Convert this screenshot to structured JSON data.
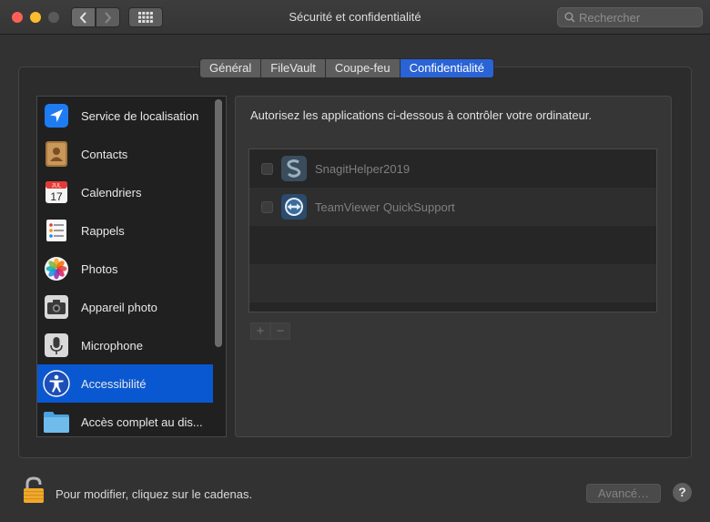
{
  "window": {
    "title": "Sécurité et confidentialité"
  },
  "search": {
    "placeholder": "Rechercher"
  },
  "tabs": [
    {
      "label": "Général",
      "active": false
    },
    {
      "label": "FileVault",
      "active": false
    },
    {
      "label": "Coupe-feu",
      "active": false
    },
    {
      "label": "Confidentialité",
      "active": true
    }
  ],
  "sidebar": {
    "items": [
      {
        "label": "Service de localisation",
        "icon": "location-arrow-icon"
      },
      {
        "label": "Contacts",
        "icon": "contacts-book-icon"
      },
      {
        "label": "Calendriers",
        "icon": "calendar-icon",
        "icon_month": "JUL",
        "icon_day": "17"
      },
      {
        "label": "Rappels",
        "icon": "reminders-list-icon"
      },
      {
        "label": "Photos",
        "icon": "photos-flower-icon"
      },
      {
        "label": "Appareil photo",
        "icon": "camera-icon"
      },
      {
        "label": "Microphone",
        "icon": "microphone-icon"
      },
      {
        "label": "Accessibilité",
        "icon": "accessibility-icon",
        "selected": true
      },
      {
        "label": "Accès complet au dis...",
        "icon": "folder-icon"
      }
    ]
  },
  "panel": {
    "description": "Autorisez les applications ci-dessous à contrôler votre ordinateur.",
    "apps": [
      {
        "name": "SnagitHelper2019",
        "checked": false,
        "icon": "snagit-icon"
      },
      {
        "name": "TeamViewer QuickSupport",
        "checked": false,
        "icon": "teamviewer-icon"
      }
    ],
    "add_label": "+",
    "remove_label": "−"
  },
  "footer": {
    "lock_text": "Pour modifier, cliquez sur le cadenas.",
    "advanced_label": "Avancé…",
    "help_label": "?"
  },
  "colors": {
    "accent": "#2a63d6",
    "selection": "#0a58d1"
  }
}
